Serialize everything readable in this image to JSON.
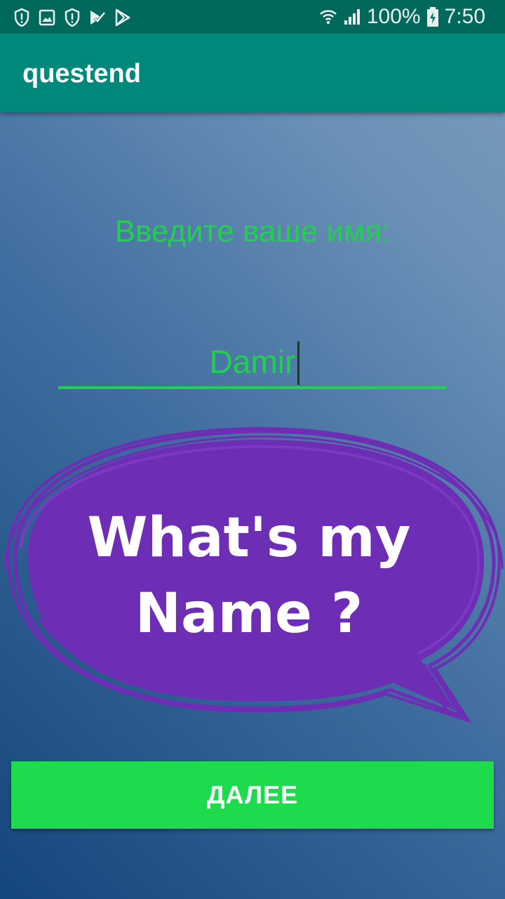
{
  "status_bar": {
    "left_icons": [
      "shield-alert-icon",
      "image-icon",
      "shield-alert-icon",
      "checkbox-play-icon",
      "play-store-icon"
    ],
    "right_icons": [
      "wifi-icon",
      "signal-icon",
      "battery-charging-icon"
    ],
    "battery": "100%",
    "time": "7:50"
  },
  "app_bar": {
    "title": "questend"
  },
  "form": {
    "prompt": "Введите ваше имя:",
    "name_value": "Damir"
  },
  "bubble": {
    "text_line1": "What's my",
    "text_line2": "Name ?"
  },
  "actions": {
    "next_label": "ДАЛЕЕ"
  },
  "colors": {
    "status_bar": "#00695c",
    "app_bar": "#00897b",
    "accent_green": "#22d04f",
    "button_green": "#1ddb4c",
    "bubble_purple": "#6e2db5"
  }
}
